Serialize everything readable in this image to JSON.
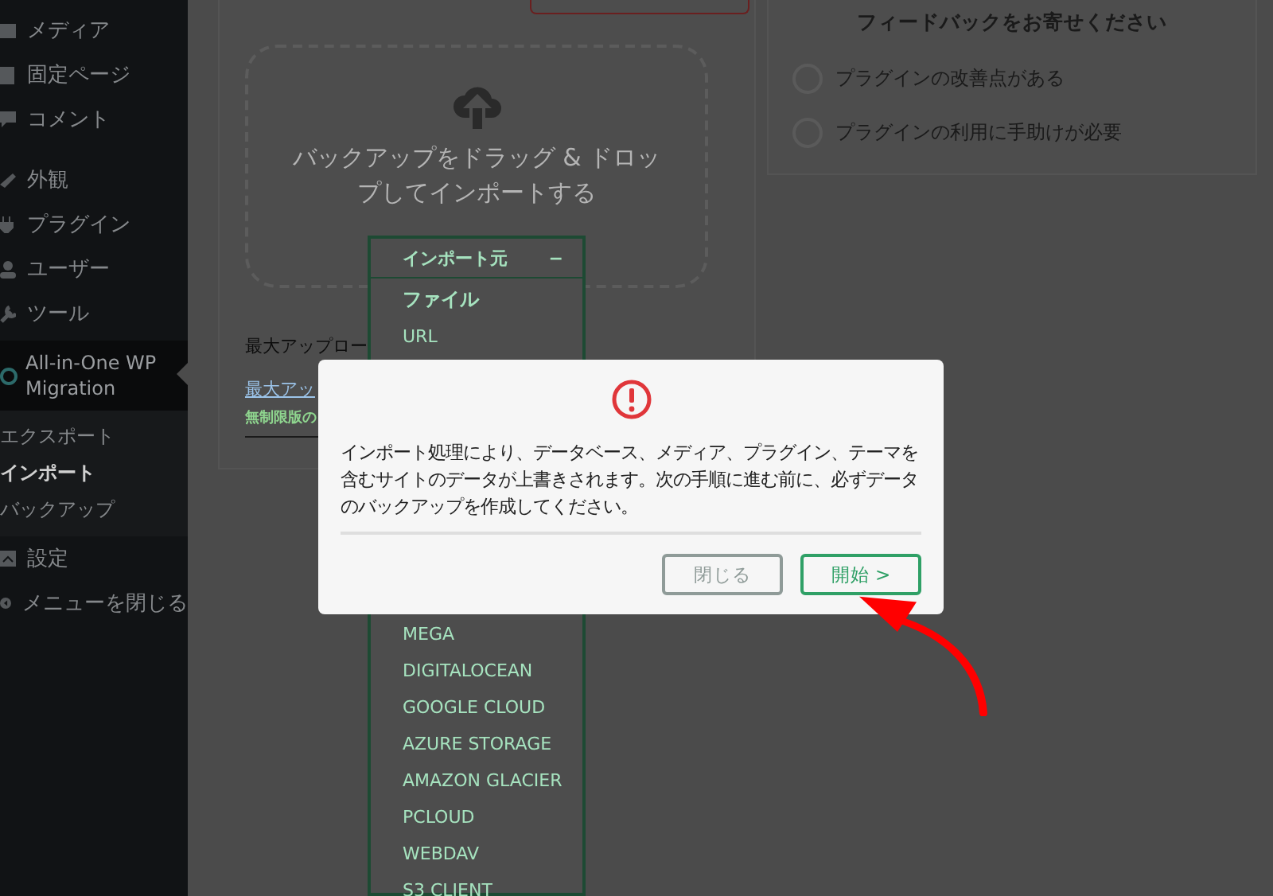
{
  "sidebar": {
    "items": [
      {
        "label": "メディア",
        "kind": "menu",
        "selected": false
      },
      {
        "label": "固定ページ",
        "kind": "menu",
        "selected": false
      },
      {
        "label": "コメント",
        "kind": "menu",
        "selected": false
      },
      {
        "label": "外観",
        "kind": "menu",
        "selected": false
      },
      {
        "label": "プラグイン",
        "kind": "menu",
        "selected": false
      },
      {
        "label": "ユーザー",
        "kind": "menu",
        "selected": false
      },
      {
        "label": "ツール",
        "kind": "menu",
        "selected": false
      },
      {
        "label": "All-in-One WP Migration",
        "kind": "plugin",
        "selected": true
      },
      {
        "label": "エクスポート",
        "kind": "submenu",
        "selected": false
      },
      {
        "label": "インポート",
        "kind": "submenu",
        "selected": true
      },
      {
        "label": "バックアップ",
        "kind": "submenu",
        "selected": false
      },
      {
        "label": "設定",
        "kind": "menu",
        "selected": false
      },
      {
        "label": "メニューを閉じる",
        "kind": "collapse",
        "selected": false
      }
    ]
  },
  "import_card": {
    "dropzone_text": "バックアップをドラッグ & ドロップしてインポートする",
    "max_upload_label": "最大アップロー",
    "max_upload_link": "最大アッ",
    "unlimited_note": "無制限版の"
  },
  "import_dropdown": {
    "title": "インポート元",
    "toggle": "−",
    "expanded": true,
    "items_top": [
      "ファイル",
      "URL"
    ],
    "items_bottom": [
      "MEGA",
      "DIGITALOCEAN",
      "GOOGLE CLOUD",
      "AZURE STORAGE",
      "AMAZON GLACIER",
      "PCLOUD",
      "WEBDAV",
      "S3 CLIENT"
    ]
  },
  "feedback": {
    "title": "フィードバックをお寄せください",
    "options": [
      {
        "label": "プラグインの改善点がある",
        "selected": false
      },
      {
        "label": "プラグインの利用に手助けが必要",
        "selected": false
      }
    ]
  },
  "modal": {
    "message": "インポート処理により、データベース、メディア、プラグイン、テーマを含むサイトのデータが上書きされます。次の手順に進む前に、必ずデータのバックアップを作成してください。",
    "buttons": [
      {
        "label": "閉じる",
        "kind": "secondary"
      },
      {
        "label": "開始 >",
        "kind": "primary"
      }
    ]
  }
}
